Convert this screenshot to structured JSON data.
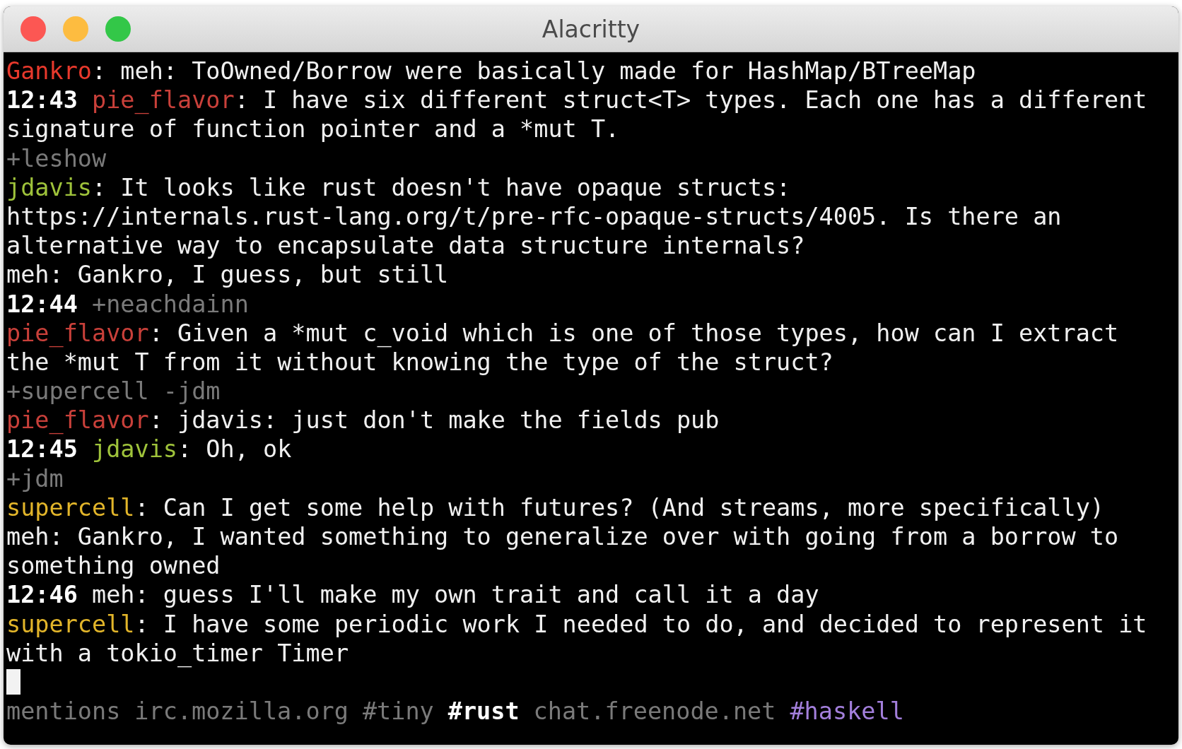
{
  "window": {
    "title": "Alacritty"
  },
  "lines": [
    {
      "segments": [
        {
          "kind": "nick",
          "text": "Gankro",
          "color": "#e8392c"
        },
        {
          "kind": "text",
          "text": ": meh: ToOwned/Borrow were basically made for HashMap/BTreeMap"
        }
      ]
    },
    {
      "segments": [
        {
          "kind": "time",
          "text": "12:43"
        },
        {
          "kind": "nick",
          "text": "pie_flavor",
          "color": "#c9403a"
        },
        {
          "kind": "text",
          "text": ": I have six different struct<T> types. Each one has a different"
        }
      ]
    },
    {
      "segments": [
        {
          "kind": "text",
          "text": "signature of function pointer and a *mut T."
        }
      ]
    },
    {
      "segments": [
        {
          "kind": "event",
          "text": "+leshow"
        }
      ]
    },
    {
      "segments": [
        {
          "kind": "nick",
          "text": "jdavis",
          "color": "#9fc33b"
        },
        {
          "kind": "text",
          "text": ": It looks like rust doesn't have opaque structs:"
        }
      ]
    },
    {
      "segments": [
        {
          "kind": "text",
          "text": "https://internals.rust-lang.org/t/pre-rfc-opaque-structs/4005. Is there an"
        }
      ]
    },
    {
      "segments": [
        {
          "kind": "text",
          "text": "alternative way to encapsulate data structure internals?"
        }
      ]
    },
    {
      "segments": [
        {
          "kind": "text",
          "text": "meh: Gankro, I guess, but still"
        }
      ]
    },
    {
      "segments": [
        {
          "kind": "time",
          "text": "12:44"
        },
        {
          "kind": "event",
          "text": "+neachdainn"
        }
      ]
    },
    {
      "segments": [
        {
          "kind": "nick",
          "text": "pie_flavor",
          "color": "#c9403a"
        },
        {
          "kind": "text",
          "text": ": Given a *mut c_void which is one of those types, how can I extract"
        }
      ]
    },
    {
      "segments": [
        {
          "kind": "text",
          "text": "the *mut T from it without knowing the type of the struct?"
        }
      ]
    },
    {
      "segments": [
        {
          "kind": "event",
          "text": "+supercell -jdm"
        }
      ]
    },
    {
      "segments": [
        {
          "kind": "nick",
          "text": "pie_flavor",
          "color": "#c9403a"
        },
        {
          "kind": "text",
          "text": ": jdavis: just don't make the fields pub"
        }
      ]
    },
    {
      "segments": [
        {
          "kind": "time",
          "text": "12:45"
        },
        {
          "kind": "nick",
          "text": "jdavis",
          "color": "#9fc33b"
        },
        {
          "kind": "text",
          "text": ": Oh, ok"
        }
      ]
    },
    {
      "segments": [
        {
          "kind": "event",
          "text": "+jdm"
        }
      ]
    },
    {
      "segments": [
        {
          "kind": "nick",
          "text": "supercell",
          "color": "#e2b52a"
        },
        {
          "kind": "text",
          "text": ": Can I get some help with futures? (And streams, more specifically)"
        }
      ]
    },
    {
      "segments": [
        {
          "kind": "text",
          "text": "meh: Gankro, I wanted something to generalize over with going from a borrow to"
        }
      ]
    },
    {
      "segments": [
        {
          "kind": "text",
          "text": "something owned"
        }
      ]
    },
    {
      "segments": [
        {
          "kind": "time",
          "text": "12:46"
        },
        {
          "kind": "text",
          "text": "meh: guess I'll make my own trait and call it a day"
        }
      ]
    },
    {
      "segments": [
        {
          "kind": "nick",
          "text": "supercell",
          "color": "#e2b52a"
        },
        {
          "kind": "text",
          "text": ": I have some periodic work I needed to do, and decided to represent it"
        }
      ]
    },
    {
      "segments": [
        {
          "kind": "text",
          "text": "with a tokio_timer Timer"
        }
      ]
    }
  ],
  "status_bar": {
    "tabs": [
      {
        "label": "mentions",
        "selected": false,
        "color": "#7a7a7a"
      },
      {
        "label": "irc.mozilla.org",
        "selected": false,
        "color": "#7a7a7a"
      },
      {
        "label": "#tiny",
        "selected": false,
        "color": "#7a7a7a"
      },
      {
        "label": "#rust",
        "selected": true,
        "color": "#ffffff"
      },
      {
        "label": "chat.freenode.net",
        "selected": false,
        "color": "#7a7a7a"
      },
      {
        "label": "#haskell",
        "selected": false,
        "color": "#a37fdc"
      }
    ]
  }
}
